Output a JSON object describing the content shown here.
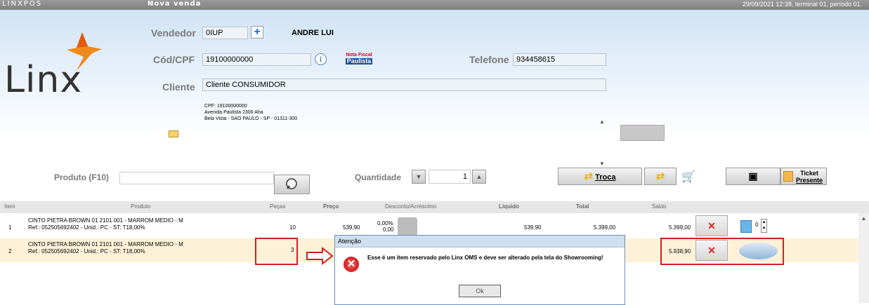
{
  "titlebar": {
    "brand": "LINXPOS",
    "screen_title": "Nova venda",
    "status": "29/09/2021 12:38, terminal 01, período 01."
  },
  "logo": {
    "text": "Linx"
  },
  "form": {
    "vendedor_label": "Vendedor",
    "vendedor_code": "0IUP",
    "vendedor_name": "ANDRE LUI",
    "cpf_label": "Cód/CPF",
    "cpf_value": "19100000000",
    "telefone_label": "Telefone",
    "telefone_value": "934458615",
    "cliente_label": "Cliente",
    "cliente_value": "Cliente CONSUMIDOR",
    "address_lines": [
      "CPF: 19100000000",
      "Avenida Paulista 2300 Aha",
      "Bela Vista - SAO PAULO - SP - 01311-300"
    ],
    "nfp_top": "Nota Fiscal",
    "nfp_bottom": "Paulista"
  },
  "product_bar": {
    "produto_label": "Produto (F10)",
    "quantidade_label": "Quantidade",
    "quantidade_value": "1",
    "troca_label": "Troca",
    "ticket_label_1": "Ticket",
    "ticket_label_2": "Presente"
  },
  "table": {
    "headers": [
      "Item",
      "Produto",
      "Peças",
      "Preço",
      "Desconto/Acréscimo",
      "Líquido",
      "Total",
      "Saldo"
    ],
    "rows": [
      {
        "item": "1",
        "produto_1": "CINTO PIETRA BROWN 01 2101 001 - MARROM MEDIO - M",
        "produto_2": "Ref.: 052505692402 - Unid.: PC - ST: T18,00%",
        "pecas": "10",
        "preco": "539,90",
        "desc_pct": "0,00%",
        "desc_val": "0,00",
        "liquido": "539,90",
        "total": "5.399,00",
        "saldo": "5.399,00",
        "gift_count": "0"
      },
      {
        "item": "2",
        "produto_1": "CINTO PIETRA BROWN 01 2101 001 - MARROM MEDIO - M",
        "produto_2": "Ref.: 052505692402 - Unid.: PC - ST: T18,00%",
        "pecas": "3",
        "saldo": "5.938,90"
      }
    ]
  },
  "dialog": {
    "title": "Atenção",
    "message": "Esse é um item reservado pelo Linx OMS e deve ser alterado pela tela do Showrooming!",
    "ok_label": "Ok"
  },
  "colors": {
    "accent_red": "#d42020",
    "logo_orange": "#f08a1c"
  }
}
